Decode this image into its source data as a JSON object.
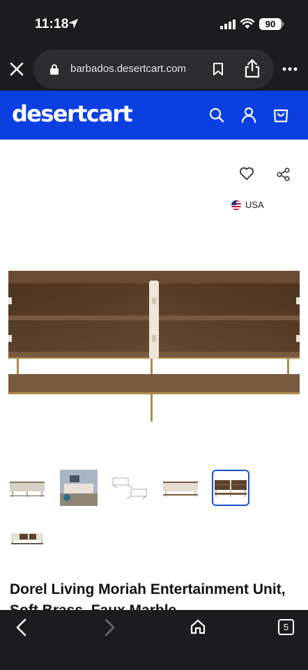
{
  "status_bar": {
    "time": "11:18",
    "battery": "90"
  },
  "browser": {
    "url": "barbados.desertcart.com",
    "tab_count": "5"
  },
  "header": {
    "logo": "desertcart"
  },
  "product": {
    "country_label": "USA",
    "title": "Dorel Living Moriah Entertainment Unit, Soft Brass, Faux Marble",
    "selected_thumbnail": 5,
    "thumbnail_count": 6
  },
  "icons": [
    "location-arrow-icon",
    "signal-icon",
    "wifi-icon",
    "close-icon",
    "lock-icon",
    "bookmark-icon",
    "share-icon",
    "more-icon",
    "search-icon",
    "user-icon",
    "cart-icon",
    "heart-icon",
    "share-nodes-icon",
    "us-flag-icon",
    "back-icon",
    "forward-icon",
    "home-icon"
  ],
  "colors": {
    "brand_blue": "#0b3fe0",
    "browser_chrome": "#1c1c1e",
    "selected_border": "#1d4ed8"
  }
}
